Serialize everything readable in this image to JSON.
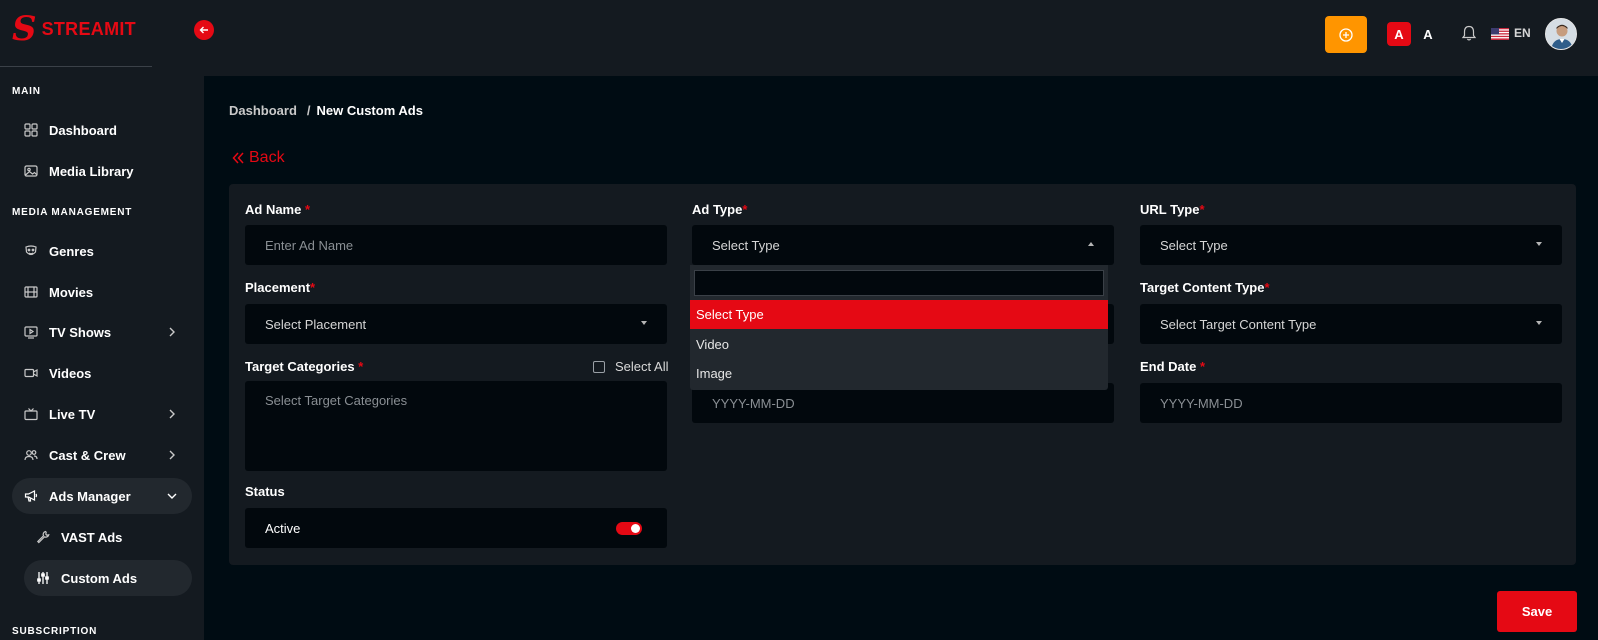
{
  "brand": {
    "name": "STREAMIT",
    "mark": "S"
  },
  "sidebar": {
    "sections": {
      "main": "MAIN",
      "media_management": "MEDIA MANAGEMENT",
      "subscription": "SUBSCRIPTION"
    },
    "items": [
      {
        "label": "Dashboard",
        "icon": "grid-icon"
      },
      {
        "label": "Media Library",
        "icon": "image-icon"
      },
      {
        "label": "Genres",
        "icon": "mask-icon"
      },
      {
        "label": "Movies",
        "icon": "film-icon"
      },
      {
        "label": "TV Shows",
        "icon": "tv-play-icon"
      },
      {
        "label": "Videos",
        "icon": "video-icon"
      },
      {
        "label": "Live TV",
        "icon": "tv-icon"
      },
      {
        "label": "Cast & Crew",
        "icon": "users-icon"
      },
      {
        "label": "Ads Manager",
        "icon": "megaphone-icon"
      },
      {
        "label": "VAST Ads",
        "icon": "wrench-icon"
      },
      {
        "label": "Custom Ads",
        "icon": "sliders-icon"
      }
    ]
  },
  "header": {
    "font_size_active": "A",
    "font_size_alt": "A",
    "language": "EN"
  },
  "breadcrumb": {
    "parent": "Dashboard",
    "separator": "/",
    "current": "New Custom Ads"
  },
  "back_label": "Back",
  "form": {
    "ad_name": {
      "label": "Ad Name",
      "placeholder": "Enter Ad Name"
    },
    "ad_type": {
      "label": "Ad Type",
      "value": "Select Type"
    },
    "url_type": {
      "label": "URL Type",
      "value": "Select Type"
    },
    "placement": {
      "label": "Placement",
      "value": "Select Placement"
    },
    "target_content_type": {
      "label": "Target Content Type",
      "value": "Select Target Content Type"
    },
    "target_categories": {
      "label": "Target Categories",
      "placeholder": "Select Target Categories",
      "select_all": "Select All"
    },
    "start_date": {
      "placeholder": "YYYY-MM-DD"
    },
    "end_date": {
      "label": "End Date",
      "placeholder": "YYYY-MM-DD"
    },
    "status": {
      "label": "Status",
      "value": "Active",
      "enabled": true
    },
    "required_mark": "*"
  },
  "dropdown": {
    "options": [
      "Select Type",
      "Video",
      "Image"
    ],
    "selected": "Select Type"
  },
  "save_label": "Save",
  "colors": {
    "accent": "#e50914",
    "add_button": "#ff9500",
    "panel": "#141a20",
    "background": "#000c13"
  }
}
